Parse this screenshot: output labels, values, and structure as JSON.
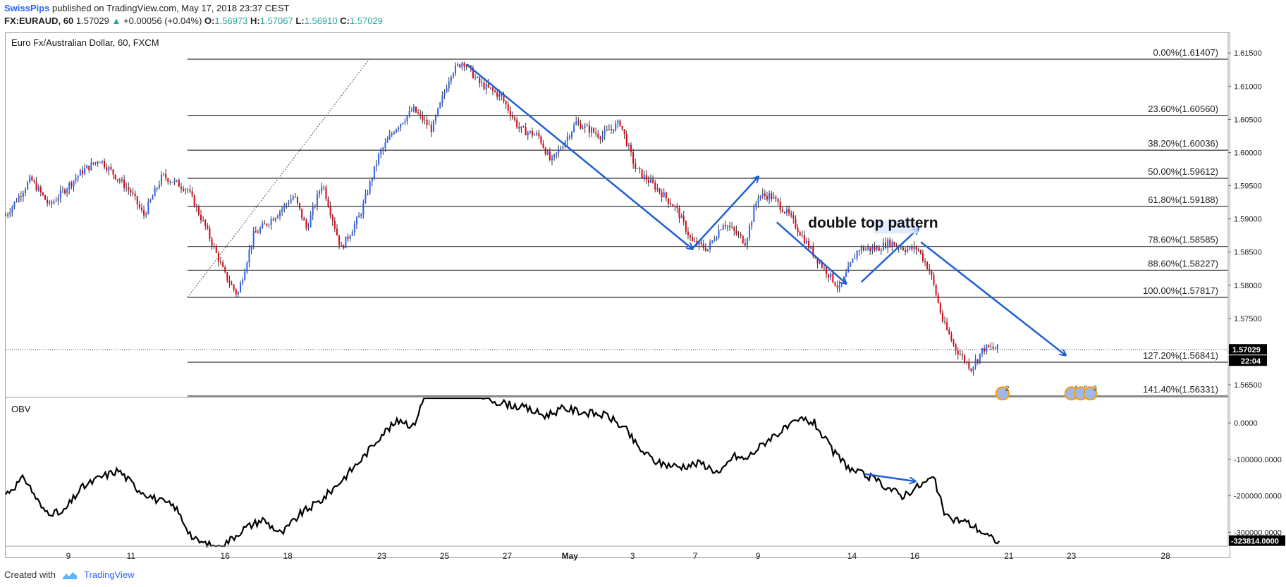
{
  "header": {
    "author": "SwissPips",
    "published": "published on TradingView.com, May 17, 2018 23:37 CEST",
    "symbol": "FX:EURAUD, 60",
    "price": "1.57029",
    "change": "+0.00056 (+0.04%)",
    "open_label": "O:",
    "open": "1.56973",
    "high_label": "H:",
    "high": "1.57067",
    "low_label": "L:",
    "low": "1.56910",
    "close_label": "C:",
    "close": "1.57029"
  },
  "chart_title": "Euro Fx/Australian Dollar, 60, FXCM",
  "indicator_title": "OBV",
  "footer": {
    "created_with": "Created with",
    "brand": "TradingView"
  },
  "colors": {
    "bull": "#2962ff",
    "bear": "#e0000f",
    "annotation": "#1f5fd6",
    "up_arrow": "#26a69a",
    "grid": "#000000"
  },
  "chart_data": [
    {
      "type": "candlestick",
      "title": "Euro Fx/Australian Dollar, 60, FXCM",
      "y_ticks": [
        "1.61500",
        "1.61000",
        "1.60500",
        "1.60000",
        "1.59500",
        "1.59000",
        "1.58500",
        "1.58000",
        "1.57500",
        "1.57000",
        "1.56500"
      ],
      "y_tick_values": [
        1.615,
        1.61,
        1.605,
        1.6,
        1.595,
        1.59,
        1.585,
        1.58,
        1.575,
        1.57,
        1.565
      ],
      "ylim": [
        1.5632,
        1.618
      ],
      "x_ticks": [
        "9",
        "11",
        "16",
        "18",
        "23",
        "25",
        "27",
        "May",
        "3",
        "7",
        "9",
        "14",
        "16",
        "21",
        "23",
        "28"
      ],
      "x_tick_pos": [
        0.0,
        1.0,
        2.5,
        3.5,
        5.0,
        6.0,
        7.0,
        8.0,
        9.0,
        10.0,
        11.0,
        12.5,
        13.5,
        15.0,
        16.0,
        17.5
      ],
      "x_range": [
        -1.0,
        18.5
      ],
      "price_path": [
        [
          -1.0,
          1.5905
        ],
        [
          -0.6,
          1.596
        ],
        [
          -0.3,
          1.592
        ],
        [
          0.2,
          1.597
        ],
        [
          0.5,
          1.599
        ],
        [
          0.8,
          1.596
        ],
        [
          1.0,
          1.594
        ],
        [
          1.2,
          1.5905
        ],
        [
          1.5,
          1.5965
        ],
        [
          1.9,
          1.5945
        ],
        [
          2.2,
          1.5885
        ],
        [
          2.5,
          1.5815
        ],
        [
          2.7,
          1.5785
        ],
        [
          2.95,
          1.5875
        ],
        [
          3.3,
          1.5905
        ],
        [
          3.6,
          1.5935
        ],
        [
          3.8,
          1.5885
        ],
        [
          4.05,
          1.5955
        ],
        [
          4.35,
          1.5855
        ],
        [
          4.65,
          1.5905
        ],
        [
          4.95,
          1.5995
        ],
        [
          5.2,
          1.6035
        ],
        [
          5.5,
          1.6065
        ],
        [
          5.8,
          1.6035
        ],
        [
          6.1,
          1.612
        ],
        [
          6.3,
          1.6138
        ],
        [
          6.55,
          1.6105
        ],
        [
          6.9,
          1.6085
        ],
        [
          7.2,
          1.6035
        ],
        [
          7.5,
          1.6025
        ],
        [
          7.7,
          1.5985
        ],
        [
          8.1,
          1.6045
        ],
        [
          8.5,
          1.6025
        ],
        [
          8.8,
          1.6045
        ],
        [
          9.05,
          1.5975
        ],
        [
          9.4,
          1.5945
        ],
        [
          9.7,
          1.5915
        ],
        [
          9.95,
          1.5865
        ],
        [
          10.2,
          1.5855
        ],
        [
          10.45,
          1.5895
        ],
        [
          10.8,
          1.5865
        ],
        [
          11.0,
          1.5935
        ],
        [
          11.2,
          1.5935
        ],
        [
          11.5,
          1.5905
        ],
        [
          11.9,
          1.5845
        ],
        [
          12.3,
          1.5795
        ],
        [
          12.6,
          1.5855
        ],
        [
          12.9,
          1.5855
        ],
        [
          13.1,
          1.5865
        ],
        [
          13.35,
          1.5855
        ],
        [
          13.55,
          1.5855
        ],
        [
          13.75,
          1.582
        ],
        [
          13.95,
          1.5745
        ],
        [
          14.15,
          1.5705
        ],
        [
          14.4,
          1.5675
        ],
        [
          14.6,
          1.5705
        ],
        [
          14.85,
          1.5705
        ]
      ],
      "last_price": "1.57029",
      "countdown": "22:04",
      "fibonacci": [
        {
          "label": "0.00%(1.61407)",
          "value": 1.61407
        },
        {
          "label": "23.60%(1.60560)",
          "value": 1.6056
        },
        {
          "label": "38.20%(1.60036)",
          "value": 1.60036
        },
        {
          "label": "50.00%(1.59612)",
          "value": 1.59612
        },
        {
          "label": "61.80%(1.59188)",
          "value": 1.59188
        },
        {
          "label": "78.60%(1.58585)",
          "value": 1.58585
        },
        {
          "label": "88.60%(1.58227)",
          "value": 1.58227
        },
        {
          "label": "100.00%(1.57817)",
          "value": 1.57817
        },
        {
          "label": "127.20%(1.56841)",
          "value": 1.56841
        },
        {
          "label": "141.40%(1.56331)",
          "value": 1.56331
        }
      ],
      "fib_x_start": 1.9,
      "annotation": "double top pattern",
      "event_markers": [
        "2",
        "1",
        "2",
        "3"
      ]
    },
    {
      "type": "line",
      "title": "OBV",
      "y_ticks": [
        "0.0000",
        "-100000.0000",
        "-200000.0000",
        "-300000.0000"
      ],
      "y_tick_values": [
        0,
        -100000,
        -200000,
        -300000
      ],
      "ylim": [
        -338000,
        68000
      ],
      "last_value": "-323814.0000",
      "series": [
        [
          -1.0,
          -195000
        ],
        [
          -0.7,
          -150000
        ],
        [
          -0.4,
          -240000
        ],
        [
          -0.1,
          -250000
        ],
        [
          0.2,
          -180000
        ],
        [
          0.5,
          -150000
        ],
        [
          0.8,
          -130000
        ],
        [
          1.1,
          -180000
        ],
        [
          1.4,
          -210000
        ],
        [
          1.7,
          -230000
        ],
        [
          2.0,
          -320000
        ],
        [
          2.4,
          -345000
        ],
        [
          2.8,
          -290000
        ],
        [
          3.1,
          -265000
        ],
        [
          3.4,
          -305000
        ],
        [
          3.7,
          -250000
        ],
        [
          4.05,
          -210000
        ],
        [
          4.4,
          -150000
        ],
        [
          4.7,
          -95000
        ],
        [
          5.0,
          -30000
        ],
        [
          5.3,
          10000
        ],
        [
          5.5,
          -10000
        ],
        [
          5.7,
          80000
        ],
        [
          6.5,
          80000
        ],
        [
          6.8,
          60000
        ],
        [
          7.3,
          40000
        ],
        [
          7.6,
          20000
        ],
        [
          7.9,
          40000
        ],
        [
          8.2,
          30000
        ],
        [
          8.6,
          20000
        ],
        [
          8.9,
          -20000
        ],
        [
          9.1,
          -70000
        ],
        [
          9.4,
          -110000
        ],
        [
          9.75,
          -120000
        ],
        [
          10.1,
          -110000
        ],
        [
          10.4,
          -140000
        ],
        [
          10.6,
          -90000
        ],
        [
          10.8,
          -100000
        ],
        [
          11.0,
          -70000
        ],
        [
          11.2,
          -40000
        ],
        [
          11.5,
          -10000
        ],
        [
          11.7,
          10000
        ],
        [
          11.9,
          0
        ],
        [
          12.2,
          -80000
        ],
        [
          12.5,
          -130000
        ],
        [
          12.8,
          -150000
        ],
        [
          13.1,
          -180000
        ],
        [
          13.3,
          -200000
        ],
        [
          13.6,
          -170000
        ],
        [
          13.8,
          -150000
        ],
        [
          14.0,
          -260000
        ],
        [
          14.3,
          -270000
        ],
        [
          14.5,
          -290000
        ],
        [
          14.75,
          -320000
        ],
        [
          14.85,
          -323814
        ]
      ]
    }
  ]
}
